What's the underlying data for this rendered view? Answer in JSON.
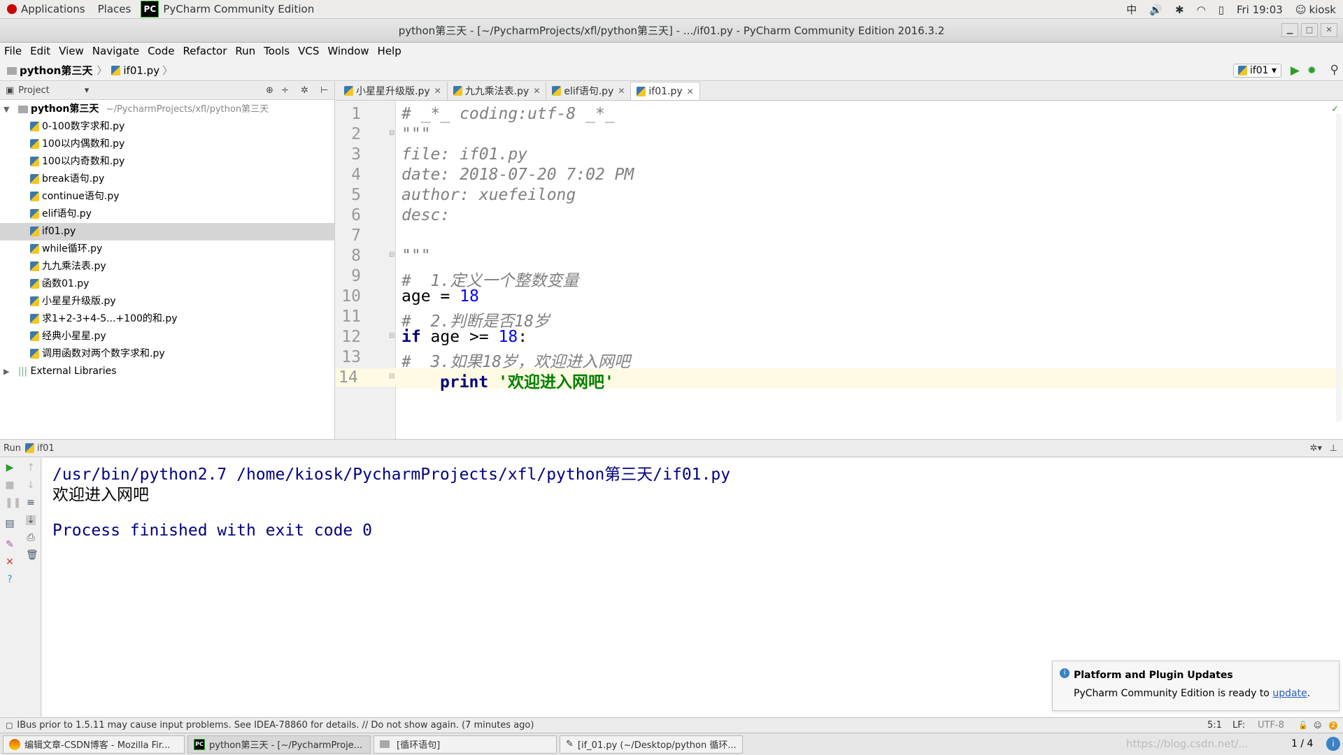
{
  "topbar": {
    "applications": "Applications",
    "places": "Places",
    "app_name": "PyCharm Community Edition",
    "input_method": "中",
    "clock": "Fri 19:03",
    "user": "kiosk"
  },
  "window": {
    "title": "python第三天 - [~/PycharmProjects/xfl/python第三天] - .../if01.py - PyCharm Community Edition 2016.3.2"
  },
  "menu": [
    "File",
    "Edit",
    "View",
    "Navigate",
    "Code",
    "Refactor",
    "Run",
    "Tools",
    "VCS",
    "Window",
    "Help"
  ],
  "navbar": {
    "project": "python第三天",
    "file": "if01.py",
    "run_config": "if01"
  },
  "project_panel": {
    "title": "Project",
    "root_name": "python第三天",
    "root_path": "~/PycharmProjects/xfl/python第三天",
    "files": [
      "0-100数字求和.py",
      "100以内偶数和.py",
      "100以内奇数和.py",
      "break语句.py",
      "continue语句.py",
      "elif语句.py",
      "if01.py",
      "while循环.py",
      "九九乘法表.py",
      "函数01.py",
      "小星星升级版.py",
      "求1+2-3+4-5...+100的和.py",
      "经典小星星.py",
      "调用函数对两个数字求和.py"
    ],
    "external": "External Libraries"
  },
  "tabs": [
    "小星星升级版.py",
    "九九乘法表.py",
    "elif语句.py",
    "if01.py"
  ],
  "code_lines": {
    "l1": "# _*_ coding:utf-8 _*_",
    "l2": "\"\"\"",
    "l3": "file: if01.py",
    "l4": "date: 2018-07-20 7:02 PM",
    "l5": "author: xuefeilong",
    "l6": "desc:",
    "l7": "",
    "l8": "\"\"\"",
    "l9": "#  1.定义一个整数变量",
    "l10_a": "age = ",
    "l10_b": "18",
    "l11": "#  2.判断是否18岁",
    "l12_a": "if",
    "l12_b": " age >= ",
    "l12_c": "18",
    "l12_d": ":",
    "l13": "#  3.如果18岁，欢迎进入网吧",
    "l14_a": "print",
    "l14_b": "'欢迎进入网吧'"
  },
  "line_numbers": [
    "1",
    "2",
    "3",
    "4",
    "5",
    "6",
    "7",
    "8",
    "9",
    "10",
    "11",
    "12",
    "13",
    "14"
  ],
  "run": {
    "label": "Run",
    "config": "if01",
    "out1": "/usr/bin/python2.7 /home/kiosk/PycharmProjects/xfl/python第三天/if01.py",
    "out2": "欢迎进入网吧",
    "out3": "Process finished with exit code 0"
  },
  "notification": {
    "title": "Platform and Plugin Updates",
    "text": "PyCharm Community Edition is ready to ",
    "link": "update",
    "period": "."
  },
  "status": {
    "message": "IBus prior to 1.5.11 may cause input problems. See IDEA-78860 for details. // Do not show again. (7 minutes ago)",
    "position": "5:1",
    "line_sep": "LF",
    "encoding": "UTF-8"
  },
  "taskbar": {
    "items": [
      "编辑文章-CSDN博客 - Mozilla Fir...",
      "python第三天 - [~/PycharmProje...",
      "[循环语句]",
      "[if_01.py (~/Desktop/python 循环..."
    ],
    "pager": "1 / 4",
    "watermark": "https://blog.csdn.net/..."
  },
  "colors": {
    "keyword": "#000080",
    "number": "#0000ff",
    "string": "#008000",
    "comment": "#808080",
    "current_line": "#fffae3"
  }
}
